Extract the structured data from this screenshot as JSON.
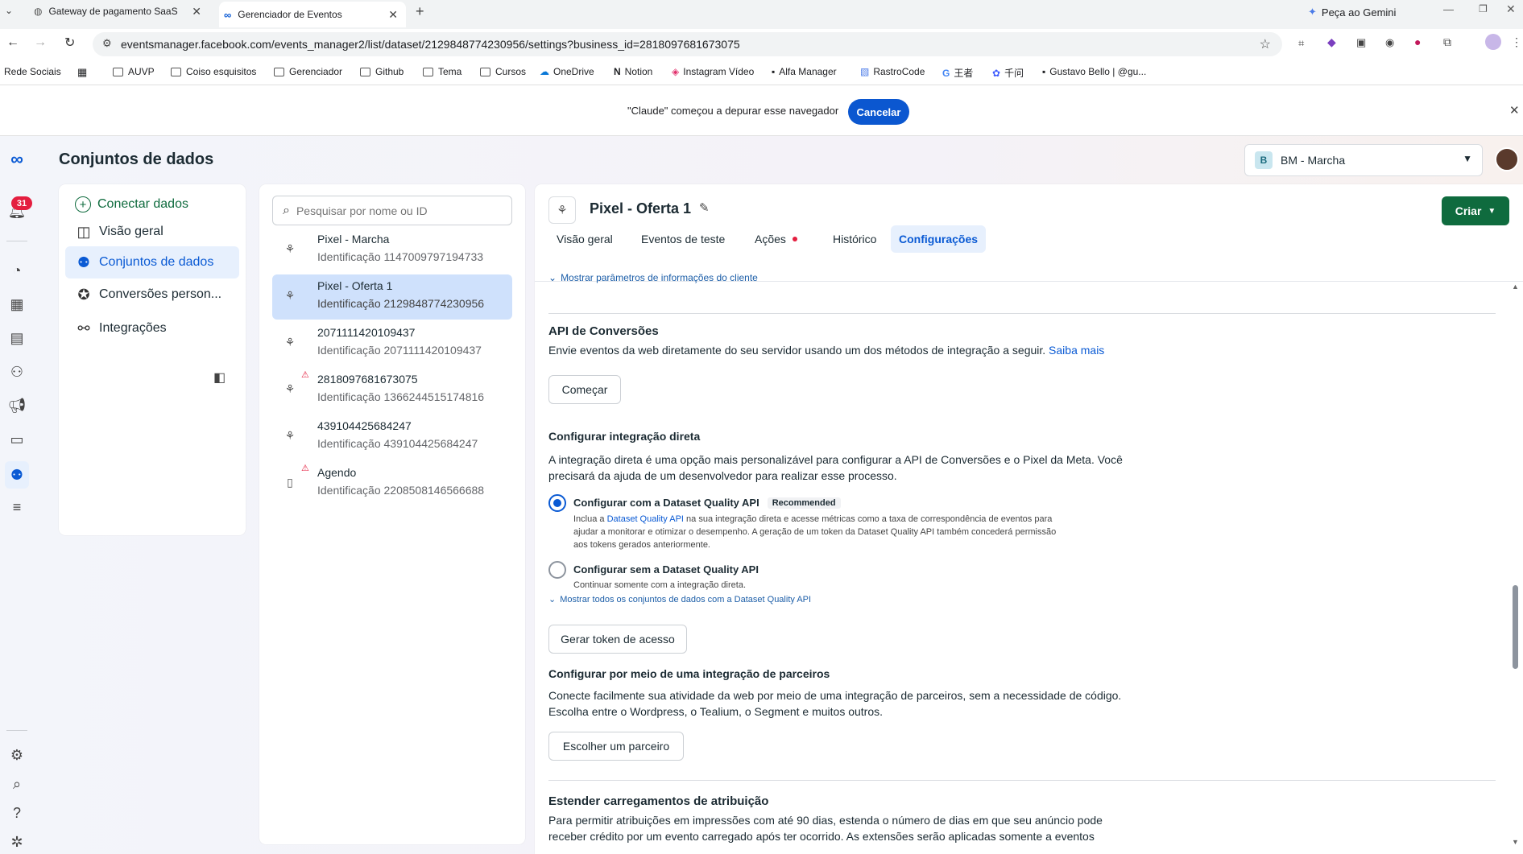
{
  "browser": {
    "tabs": [
      {
        "title": "Gateway de pagamento SaaS"
      },
      {
        "title": "Gerenciador de Eventos"
      }
    ],
    "gemini_label": "Peça ao Gemini",
    "url": "eventsmanager.facebook.com/events_manager2/list/dataset/2129848774230956/settings?business_id=2818097681673075",
    "bookmarks": [
      "Rede Sociais",
      "AUVP",
      "Coiso esquisitos",
      "Gerenciador",
      "Github",
      "Tema",
      "Cursos",
      "OneDrive",
      "Notion",
      "Instagram Vídeo",
      "Alfa Manager",
      "RastroCode",
      "王者",
      "千问",
      "Gustavo Bello | @gu..."
    ],
    "infobar_text": "\"Claude\" começou a depurar esse navegador",
    "infobar_cancel": "Cancelar"
  },
  "header": {
    "title": "Conjuntos de dados",
    "account_badge": "B",
    "account_name": "BM - Marcha",
    "notifications_count": "31"
  },
  "sidebar": {
    "items": [
      {
        "label": "Conectar dados",
        "icon": "plus-circle-icon"
      },
      {
        "label": "Visão geral",
        "icon": "layout-icon"
      },
      {
        "label": "Conjuntos de dados",
        "icon": "people-icon"
      },
      {
        "label": "Conversões person...",
        "icon": "star-icon"
      },
      {
        "label": "Integrações",
        "icon": "nodes-icon"
      }
    ]
  },
  "datasets": {
    "search_placeholder": "Pesquisar por nome ou ID",
    "items": [
      {
        "name": "Pixel - Marcha",
        "id": "Identificação 1147009797194733",
        "warning": false
      },
      {
        "name": "Pixel - Oferta 1",
        "id": "Identificação 2129848774230956",
        "warning": false
      },
      {
        "name": "2071111420109437",
        "id": "Identificação 2071111420109437",
        "warning": false
      },
      {
        "name": "2818097681673075",
        "id": "Identificação 1366244515174816",
        "warning": true
      },
      {
        "name": "439104425684247",
        "id": "Identificação 439104425684247",
        "warning": false
      },
      {
        "name": "Agendo",
        "id": "Identificação 2208508146566688",
        "warning": true
      }
    ]
  },
  "detail": {
    "title": "Pixel - Oferta 1",
    "create_label": "Criar",
    "tabs": [
      "Visão geral",
      "Eventos de teste",
      "Ações",
      "Histórico",
      "Configurações"
    ],
    "show_customer_params": "Mostrar parâmetros de informações do cliente",
    "capi": {
      "title": "API de Conversões",
      "desc": "Envie eventos da web diretamente do seu servidor usando um dos métodos de integração a seguir.",
      "learn_more": "Saiba mais",
      "start_label": "Começar"
    },
    "direct": {
      "title": "Configurar integração direta",
      "desc1": "A integração direta é uma opção mais personalizável para configurar a API de Conversões e o Pixel da Meta. Você",
      "desc2": "precisará da ajuda de um desenvolvedor para realizar esse processo.",
      "opt1_title": "Configurar com a Dataset Quality API",
      "opt1_badge": "Recommended",
      "opt1_l1a": "Inclua a ",
      "opt1_l1link": "Dataset Quality API",
      "opt1_l1b": " na sua integração direta e acesse métricas como a taxa de correspondência de eventos para",
      "opt1_l2": "ajudar a monitorar e otimizar o desempenho. A geração de um token da Dataset Quality API também concederá permissão",
      "opt1_l3": "aos tokens gerados anteriormente.",
      "opt2_title": "Configurar sem a Dataset Quality API",
      "opt2_desc": "Continuar somente com a integração direta.",
      "show_all": "Mostrar todos os conjuntos de dados com a Dataset Quality API",
      "token_label": "Gerar token de acesso"
    },
    "partner": {
      "title": "Configurar por meio de uma integração de parceiros",
      "desc1": "Conecte facilmente sua atividade da web por meio de uma integração de parceiros, sem a necessidade de código.",
      "desc2": "Escolha entre o Wordpress, o Tealium, o Segment e muitos outros.",
      "choose_label": "Escolher um parceiro"
    },
    "attribution": {
      "title": "Estender carregamentos de atribuição",
      "desc1": "Para permitir atribuições em impressões com até 90 dias, estenda o número de dias em que seu anúncio pode",
      "desc2": "receber crédito por um evento carregado após ter ocorrido. As extensões serão aplicadas somente a eventos"
    }
  },
  "colors": {
    "accent": "#0a5ad4",
    "create_button": "#0f6b3e",
    "selected_bg": "#cfe1fc",
    "alert": "#e41e3f"
  }
}
